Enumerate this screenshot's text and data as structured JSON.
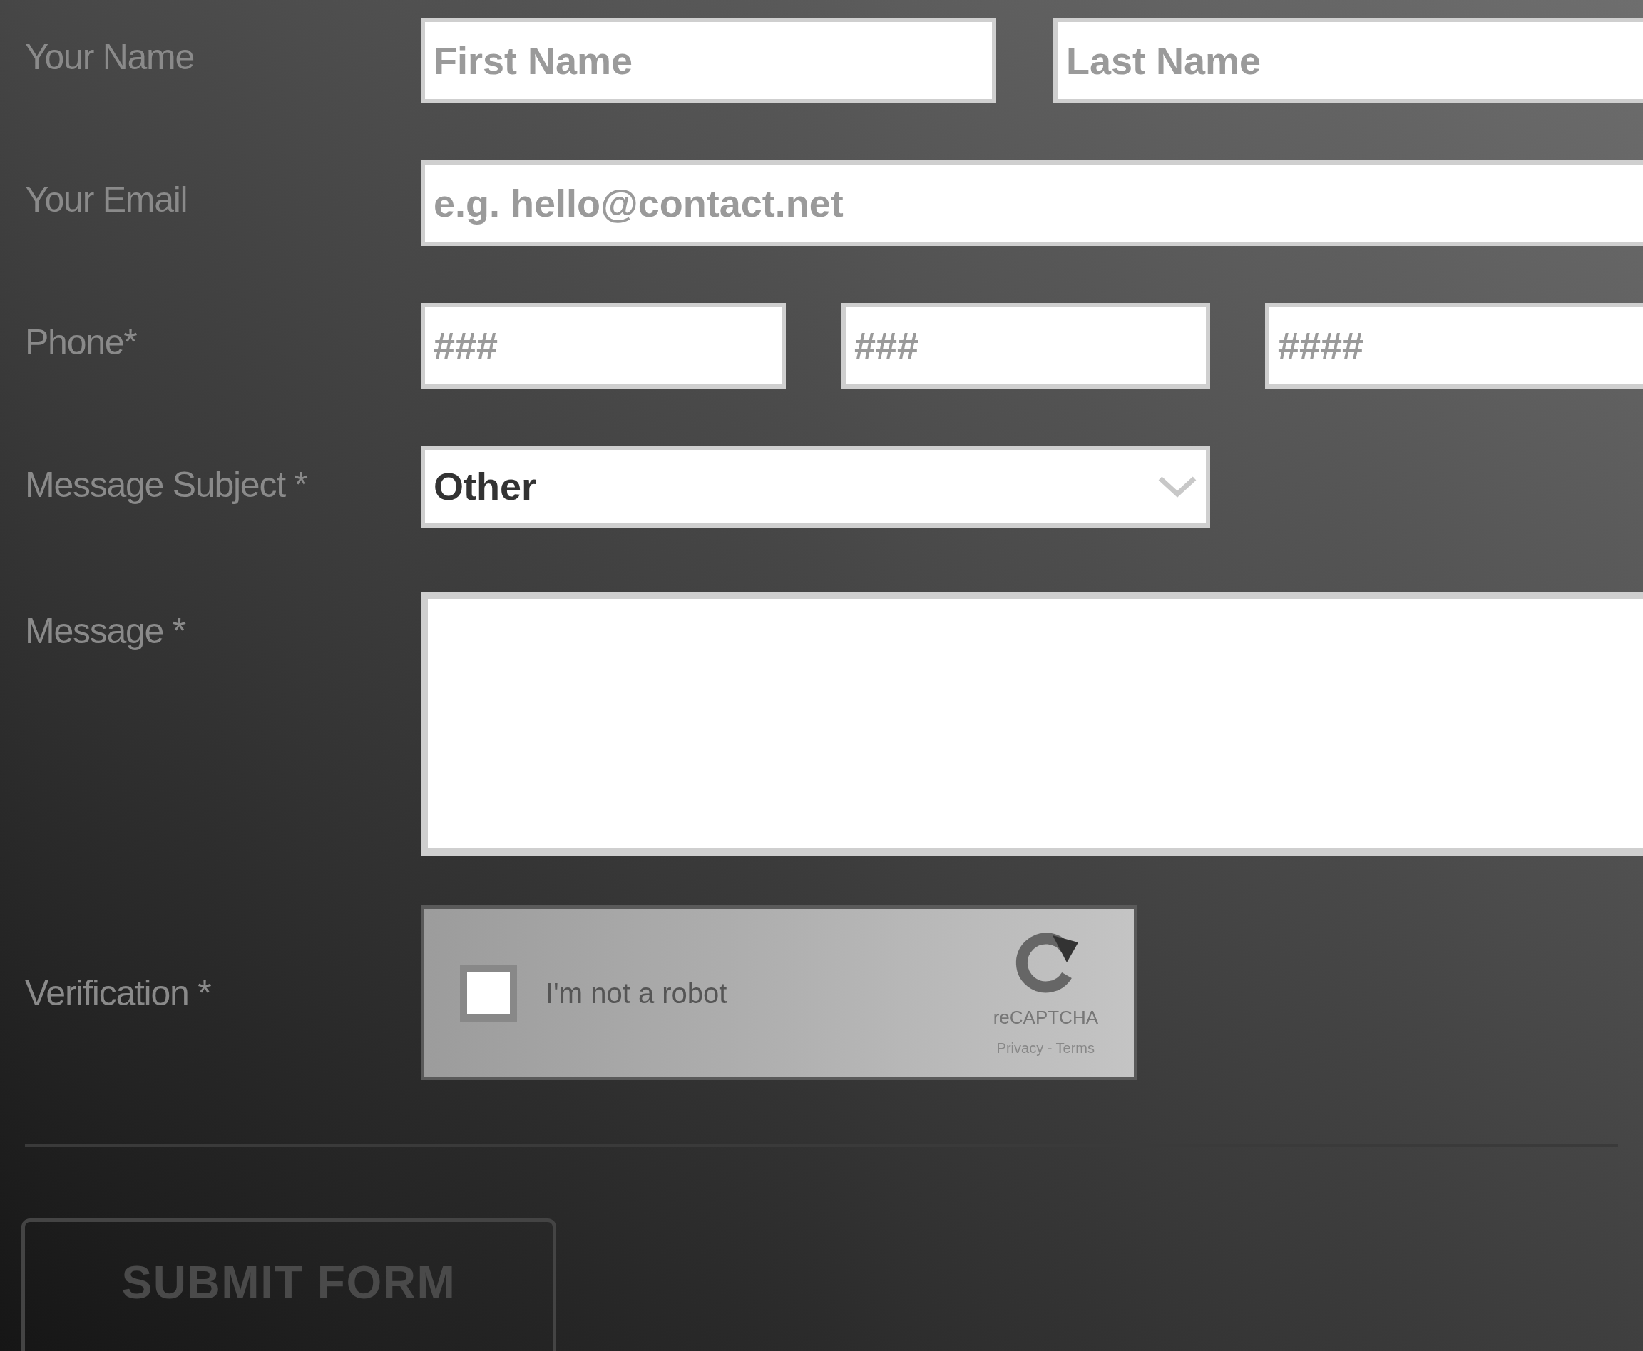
{
  "name": {
    "label": "Your Name",
    "first_placeholder": "First Name",
    "last_placeholder": "Last Name"
  },
  "email": {
    "label": "Your Email",
    "placeholder": "e.g. hello@contact.net"
  },
  "phone": {
    "label": "Phone*",
    "placeholders": [
      "###",
      "###",
      "####"
    ]
  },
  "subject": {
    "label": "Message Subject *",
    "value": "Other"
  },
  "message": {
    "label": "Message *"
  },
  "verification": {
    "label": "Verification *",
    "checkbox_label": "I'm not a robot",
    "checked": false,
    "brand": "reCAPTCHA",
    "links": "Privacy - Terms"
  },
  "submit": {
    "label": "SUBMIT FORM"
  }
}
